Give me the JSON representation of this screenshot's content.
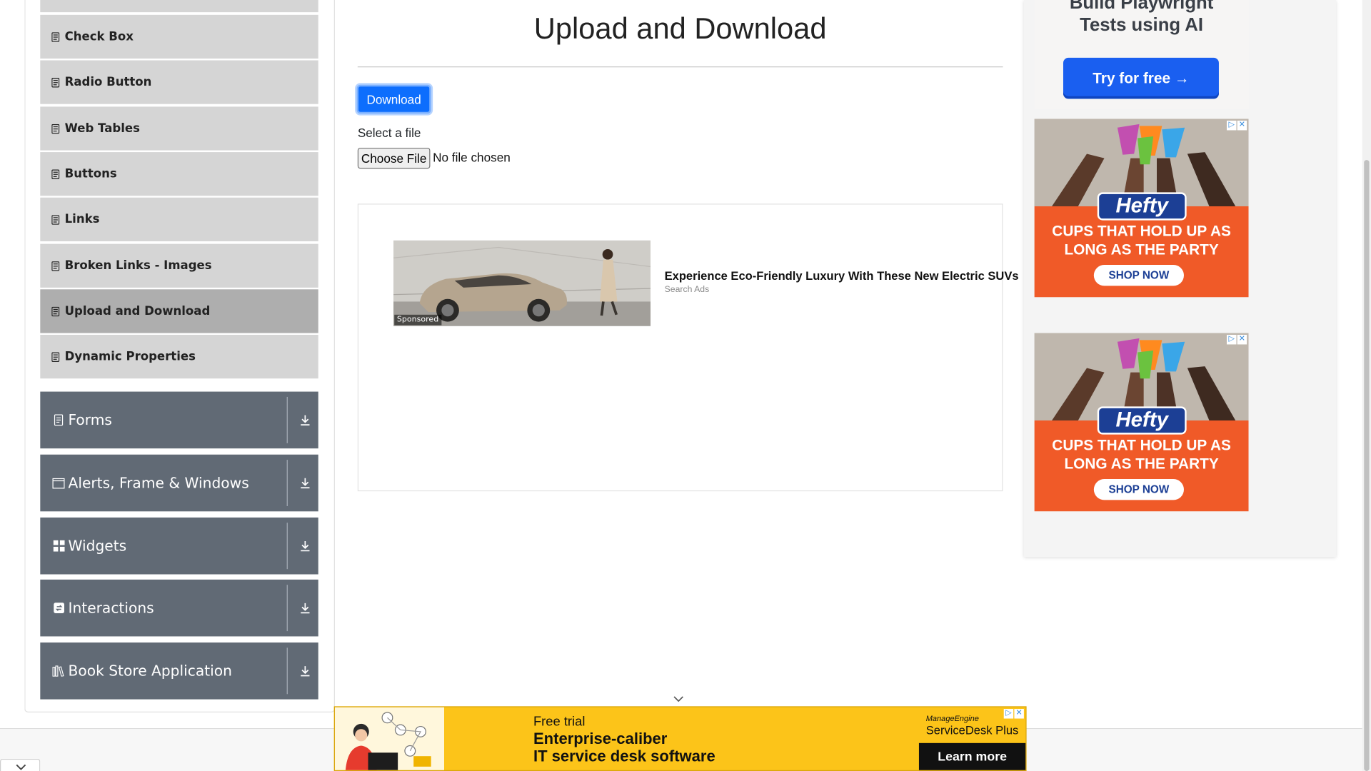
{
  "sidebar": {
    "elements_items": [
      {
        "label": "Check Box",
        "active": false
      },
      {
        "label": "Radio Button",
        "active": false
      },
      {
        "label": "Web Tables",
        "active": false
      },
      {
        "label": "Buttons",
        "active": false
      },
      {
        "label": "Links",
        "active": false
      },
      {
        "label": "Broken Links - Images",
        "active": false
      },
      {
        "label": "Upload and Download",
        "active": true
      },
      {
        "label": "Dynamic Properties",
        "active": false
      }
    ],
    "groups": [
      {
        "label": "Forms",
        "icon": "document-icon"
      },
      {
        "label": "Alerts, Frame & Windows",
        "icon": "window-icon"
      },
      {
        "label": "Widgets",
        "icon": "widgets-icon"
      },
      {
        "label": "Interactions",
        "icon": "interactions-icon"
      },
      {
        "label": "Book Store Application",
        "icon": "books-icon"
      }
    ]
  },
  "main": {
    "title": "Upload and Download",
    "download_label": "Download",
    "select_label": "Select a file",
    "choose_file_label": "Choose File",
    "no_file_text": "No file chosen"
  },
  "center_ad": {
    "sponsored_label": "Sponsored",
    "headline": "Experience Eco-Friendly Luxury With These New Electric SUVs",
    "source": "Search Ads"
  },
  "right_ads": {
    "playwright": {
      "line1": "Build Playwright",
      "line2": "Tests using AI",
      "cta": "Try for free →"
    },
    "hefty": {
      "brand": "Hefty",
      "tagline_line1": "CUPS THAT HOLD UP AS",
      "tagline_line2": "LONG AS THE PARTY",
      "cta": "SHOP NOW"
    }
  },
  "bottom_ad": {
    "line1": "Free trial",
    "line2": "Enterprise-caliber",
    "line3": "IT service desk software",
    "brand_small": "ManageEngine",
    "brand": "ServiceDesk Plus",
    "cta": "Learn more"
  },
  "colors": {
    "primary": "#0d6efd",
    "sidebar_group": "#616a75",
    "menu_item": "#d5d5d5",
    "menu_item_active": "#aeaeae",
    "banner_yellow": "#fcc419",
    "hefty_orange": "#f05a28"
  }
}
